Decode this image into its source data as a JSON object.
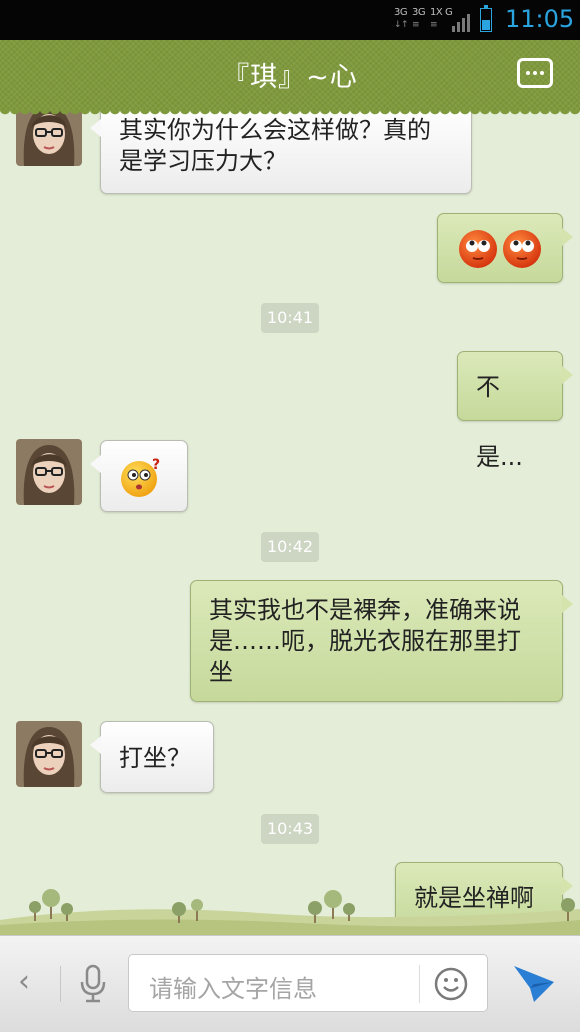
{
  "status_bar": {
    "network_labels": [
      "3G",
      "3G",
      "1X",
      "G"
    ],
    "time": "11:05",
    "accent_color": "#2aa5e0",
    "battery_level_percent": 45
  },
  "header": {
    "title": "『琪』~心",
    "menu_icon": "more-dots-icon",
    "background_color": "#7f9a3c"
  },
  "messages": [
    {
      "side": "left",
      "type": "text",
      "text": "其实你为什么会这样做？真的是学习压力大？"
    },
    {
      "side": "right",
      "type": "emoji",
      "emoji": "rolling-eyes-face",
      "count": 2
    },
    {
      "type": "timestamp",
      "text": "10:41"
    },
    {
      "side": "right",
      "type": "text",
      "text": "不是..."
    },
    {
      "side": "left",
      "type": "emoji",
      "emoji": "confused-face",
      "count": 1
    },
    {
      "type": "timestamp",
      "text": "10:42"
    },
    {
      "side": "right",
      "type": "text",
      "text": "其实我也不是裸奔，准确来说是……呃，脱光衣服在那里打坐"
    },
    {
      "side": "left",
      "type": "text",
      "text": "打坐？"
    },
    {
      "type": "timestamp",
      "text": "10:43"
    },
    {
      "side": "right",
      "type": "text",
      "text": "就是坐禅啊"
    }
  ],
  "input_bar": {
    "placeholder": "请输入文字信息",
    "back_icon": "chevron-left-icon",
    "voice_icon": "microphone-icon",
    "emoji_icon": "smiley-icon",
    "send_icon": "paper-plane-icon",
    "send_color": "#2a7fd4"
  }
}
